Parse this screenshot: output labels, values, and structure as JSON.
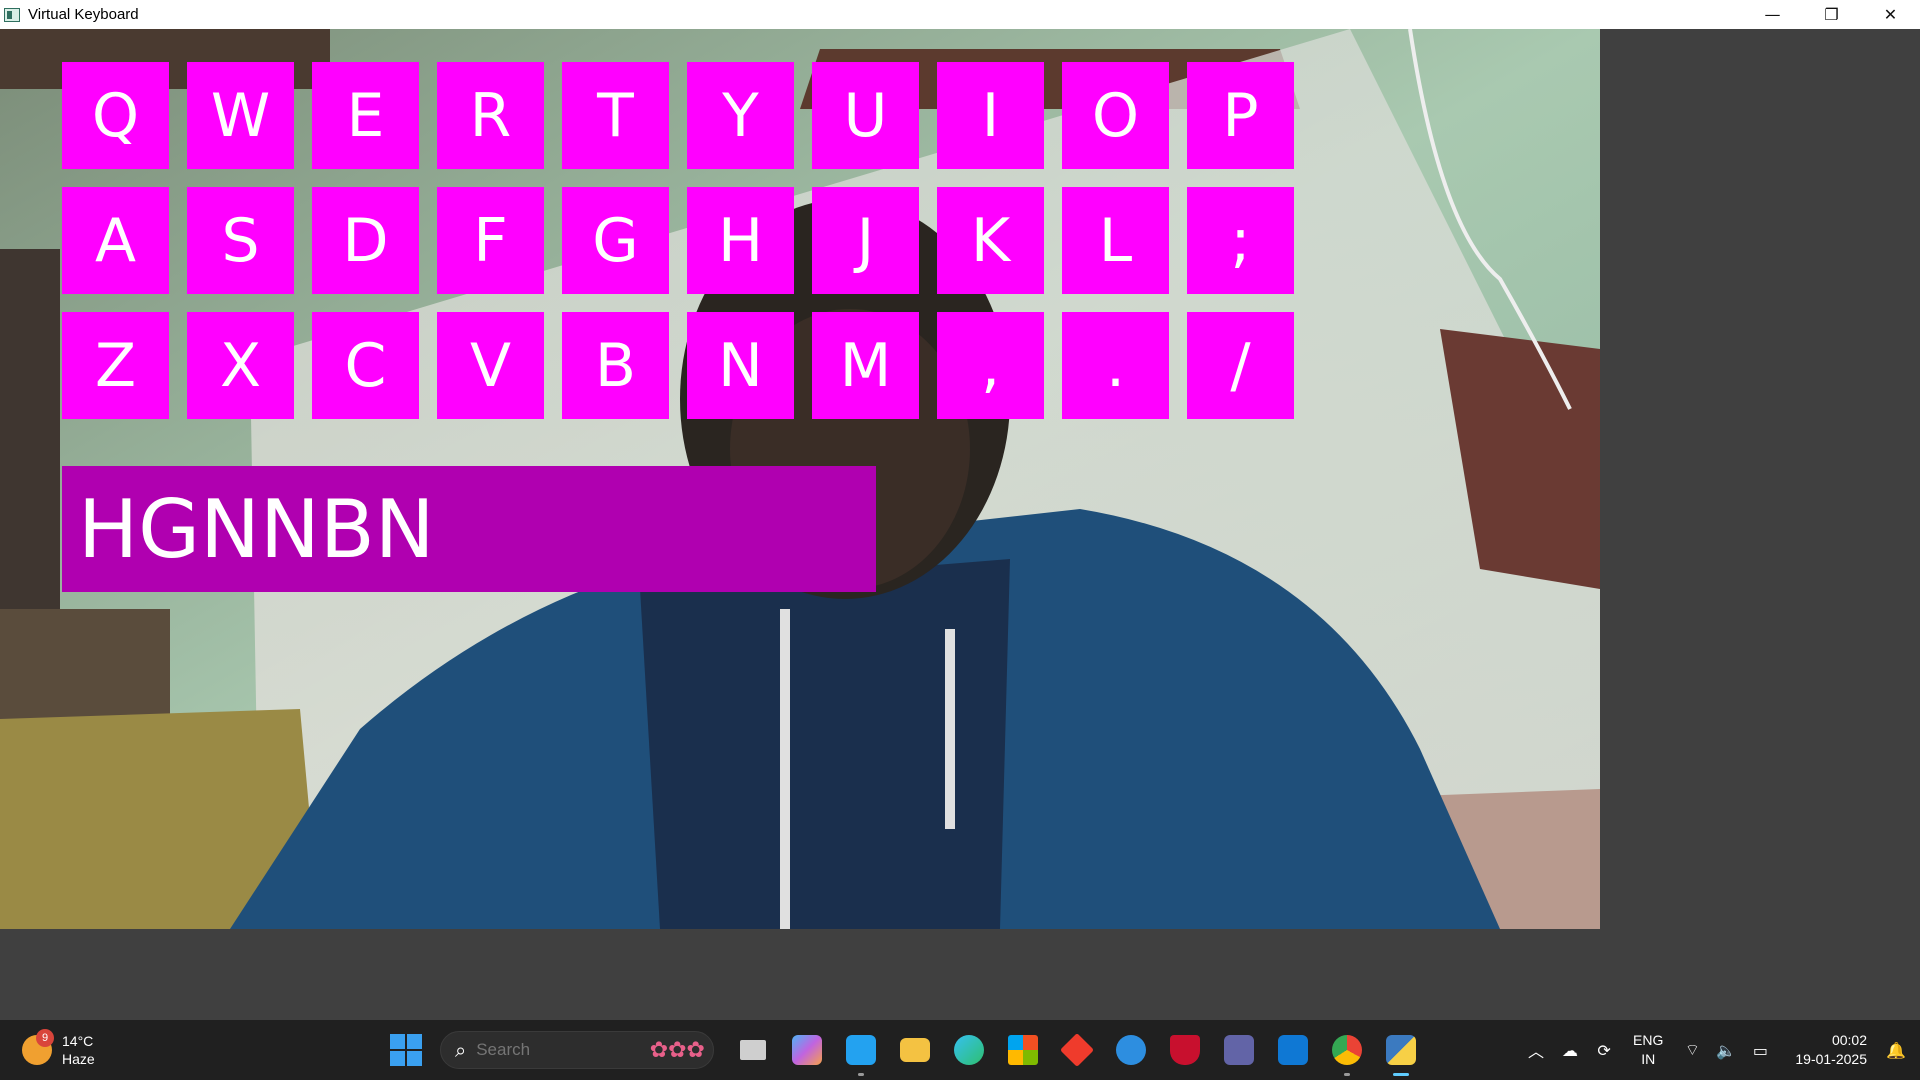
{
  "window": {
    "title": "Virtual Keyboard",
    "minimize": "—",
    "restore": "❐",
    "close": "✕"
  },
  "keyboard": {
    "rows": [
      [
        "Q",
        "W",
        "E",
        "R",
        "T",
        "Y",
        "U",
        "I",
        "O",
        "P"
      ],
      [
        "A",
        "S",
        "D",
        "F",
        "G",
        "H",
        "J",
        "K",
        "L",
        ";"
      ],
      [
        "Z",
        "X",
        "C",
        "V",
        "B",
        "N",
        "M",
        ",",
        ".",
        "/"
      ]
    ],
    "key_color": "#ff00ff",
    "typed_text": "HGNNBN",
    "typed_box_color": "#b000b0"
  },
  "taskbar": {
    "weather": {
      "temp": "14°C",
      "condition": "Haze",
      "badge": "9"
    },
    "search": {
      "placeholder": "Search"
    },
    "apps": [
      {
        "name": "task-view",
        "color": "#cfcfcf"
      },
      {
        "name": "copilot",
        "color": "#8a6cf0"
      },
      {
        "name": "vscode",
        "color": "#23a2f0"
      },
      {
        "name": "file-explorer",
        "color": "#f4c242"
      },
      {
        "name": "edge",
        "color": "#1fa3c9"
      },
      {
        "name": "microsoft-store",
        "color": "#e6e6e6"
      },
      {
        "name": "anydesk",
        "color": "#ef3b2c"
      },
      {
        "name": "get-help",
        "color": "#2d8ee0"
      },
      {
        "name": "mcafee",
        "color": "#c8102e"
      },
      {
        "name": "teams",
        "color": "#6264a7"
      },
      {
        "name": "outlook",
        "color": "#0f78d4"
      },
      {
        "name": "chrome",
        "color": "#2ea64f"
      },
      {
        "name": "python",
        "color": "#3b7ac0"
      }
    ],
    "tray": {
      "lang_top": "ENG",
      "lang_bottom": "IN",
      "time": "00:02",
      "date": "19-01-2025"
    }
  }
}
